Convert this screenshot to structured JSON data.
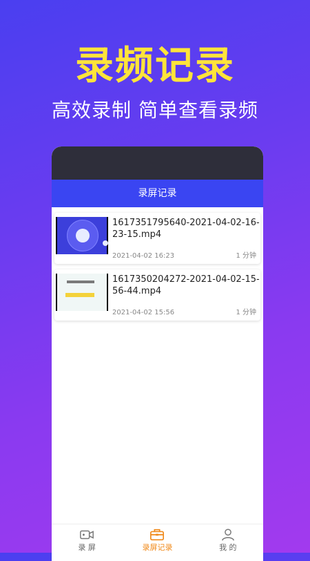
{
  "hero": {
    "title": "录频记录",
    "subtitle": "高效录制 简单查看录频"
  },
  "app": {
    "header_title": "录屏记录"
  },
  "recordings": [
    {
      "filename": "1617351795640-2021-04-02-16-23-15.mp4",
      "date": "2021-04-02 16:23",
      "duration": "1 分钟"
    },
    {
      "filename": "1617350204272-2021-04-02-15-56-44.mp4",
      "date": "2021-04-02 15:56",
      "duration": "1 分钟"
    }
  ],
  "tabs": [
    {
      "label": "录 屏",
      "icon": "video-camera-icon"
    },
    {
      "label": "录屏记录",
      "icon": "briefcase-icon"
    },
    {
      "label": "我 的",
      "icon": "user-icon"
    }
  ],
  "colors": {
    "title_yellow": "#ffe43a",
    "header_blue": "#3a45f2",
    "active_tab": "#f08a1b"
  }
}
